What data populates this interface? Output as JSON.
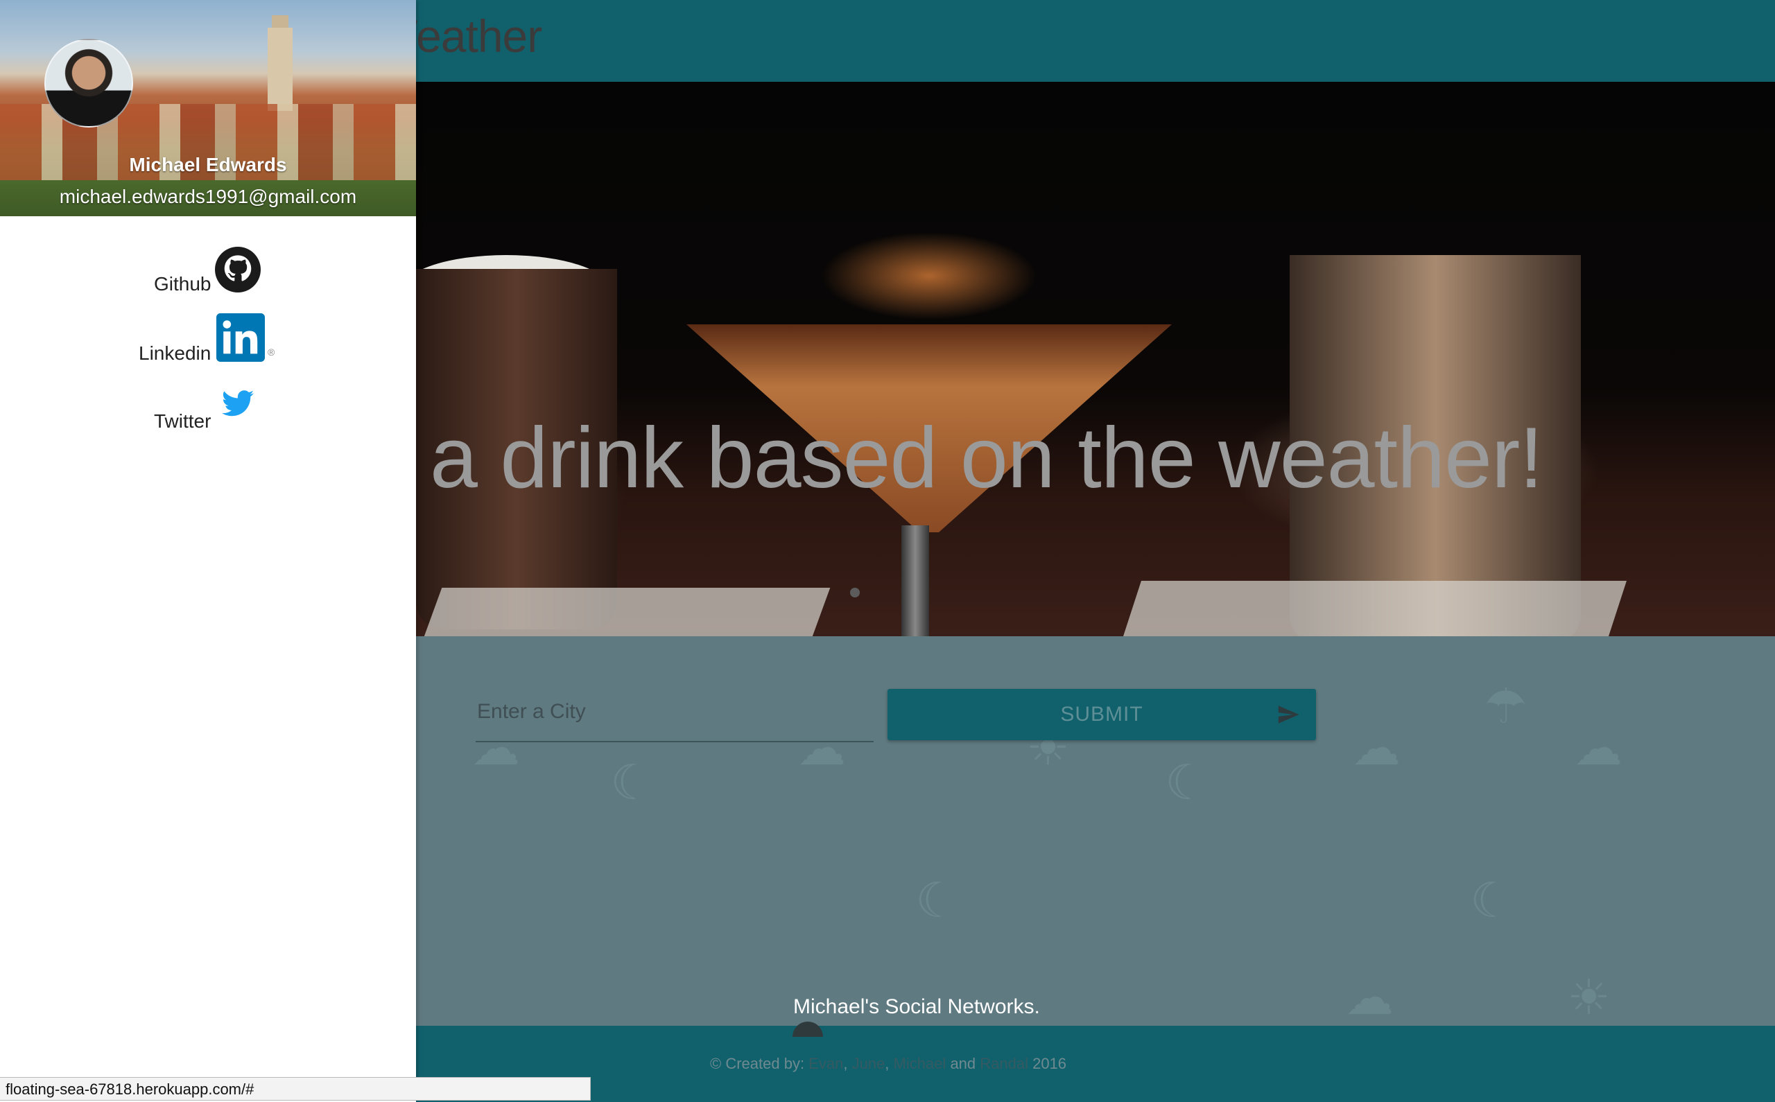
{
  "navbar": {
    "brand": "Weather"
  },
  "hero": {
    "tagline": "a drink based on the weather!"
  },
  "form": {
    "city_placeholder": "Enter a City",
    "submit_label": "SUBMIT",
    "submit_icon": "send-icon"
  },
  "footer": {
    "social_title": "Michael's Social Networks.",
    "copyright_prefix": "© Created by: ",
    "authors": [
      "Evan",
      "June",
      "Michael",
      "Randal"
    ],
    "sep1": ", ",
    "sep2": ", ",
    "and": " and ",
    "year": " 2016"
  },
  "drawer": {
    "user": {
      "name": "Michael Edwards",
      "email": "michael.edwards1991@gmail.com"
    },
    "links": [
      {
        "label": "Github",
        "icon": "github-icon"
      },
      {
        "label": "Linkedin",
        "icon": "linkedin-icon"
      },
      {
        "label": "Twitter",
        "icon": "twitter-icon"
      }
    ]
  },
  "status_bar": {
    "url": "floating-sea-67818.herokuapp.com/#"
  },
  "colors": {
    "nav": "#11616d",
    "overlay_bg": "#5f7a81",
    "drawer": "#ffffff",
    "linkedin": "#0077b5",
    "twitter": "#1da1f2"
  }
}
